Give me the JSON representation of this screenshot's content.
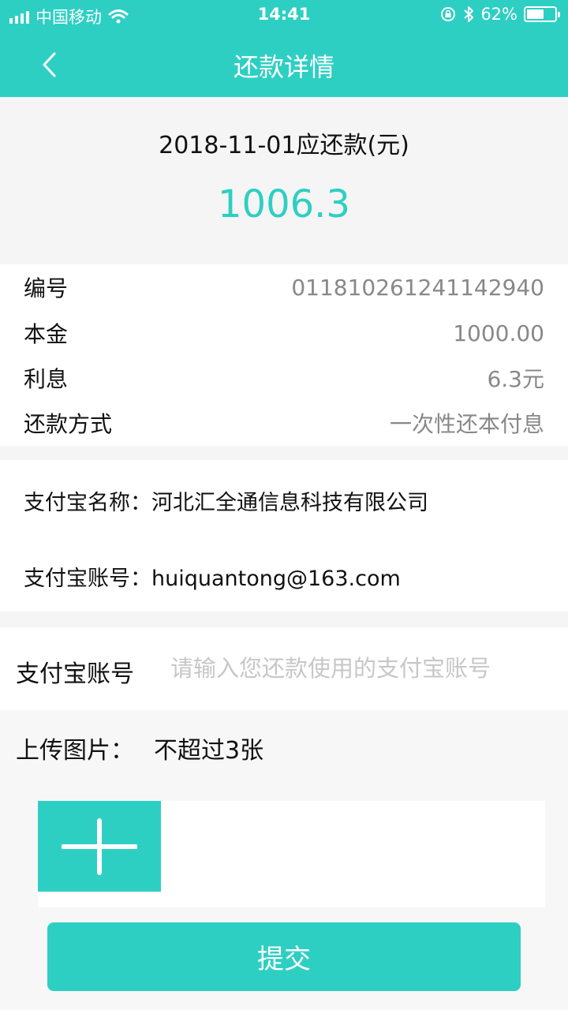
{
  "status": {
    "carrier": "中国移动",
    "time": "14:41",
    "battery_text": "62%",
    "battery_level": 0.62
  },
  "nav": {
    "title": "还款详情"
  },
  "summary": {
    "label": "2018-11-01应还款(元)",
    "amount": "1006.3"
  },
  "details": [
    {
      "key": "编号",
      "value": "011810261241142940"
    },
    {
      "key": "本金",
      "value": "1000.00"
    },
    {
      "key": "利息",
      "value": "6.3元"
    },
    {
      "key": "还款方式",
      "value": "一次性还本付息"
    }
  ],
  "alipay": {
    "name_line": "支付宝名称：河北汇全通信息科技有限公司",
    "account_line": "支付宝账号：huiquantong@163.com"
  },
  "input": {
    "label": "支付宝账号",
    "value": "",
    "placeholder": "请输入您还款使用的支付宝账号"
  },
  "upload": {
    "title": "上传图片：",
    "hint": "不超过3张"
  },
  "submit": {
    "label": "提交"
  },
  "colors": {
    "accent": "#2ecfc3"
  }
}
